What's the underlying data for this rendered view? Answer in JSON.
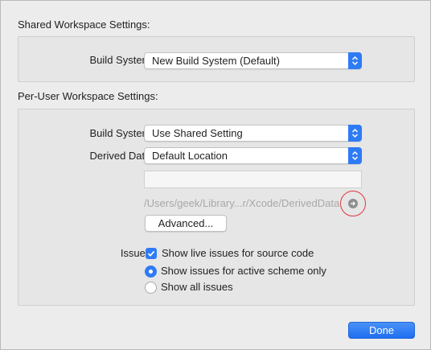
{
  "shared": {
    "title": "Shared Workspace Settings:",
    "build_system_label": "Build System:",
    "build_system_value": "New Build System (Default)"
  },
  "per_user": {
    "title": "Per-User Workspace Settings:",
    "build_system_label": "Build System:",
    "build_system_value": "Use Shared Setting",
    "derived_data_label": "Derived Data:",
    "derived_data_value": "Default Location",
    "custom_path_value": "",
    "derived_path": "/Users/geek/Library...r/Xcode/DerivedData",
    "advanced_button": "Advanced...",
    "issues_label": "Issues:",
    "show_live_issues": {
      "label": "Show live issues for source code",
      "checked": true
    },
    "issue_scope": {
      "options": [
        "Show issues for active scheme only",
        "Show all issues"
      ],
      "selected": "Show issues for active scheme only"
    }
  },
  "footer": {
    "done_button": "Done"
  },
  "colors": {
    "accent": "#2f7bf5",
    "highlight_ring": "#e0383e"
  },
  "icons": {
    "popup_arrows": "chevron-up-down-icon",
    "reveal": "arrow-right-circle-icon",
    "checkmark": "checkmark-icon"
  }
}
